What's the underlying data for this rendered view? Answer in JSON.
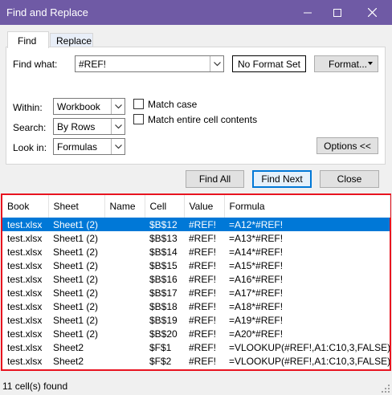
{
  "window": {
    "title": "Find and Replace"
  },
  "tabs": {
    "find": "Find",
    "replace": "Replace"
  },
  "find_what": {
    "label": "Find what:",
    "value": "#REF!",
    "format_status": "No Format Set",
    "format_button": "Format..."
  },
  "within": {
    "label": "Within:",
    "value": "Workbook"
  },
  "search": {
    "label": "Search:",
    "value": "By Rows"
  },
  "look_in": {
    "label": "Look in:",
    "value": "Formulas"
  },
  "options": {
    "match_case": "Match case",
    "match_entire": "Match entire cell contents",
    "options_button": "Options <<"
  },
  "actions": {
    "find_all": "Find All",
    "find_next": "Find Next",
    "close": "Close"
  },
  "results": {
    "columns": [
      "Book",
      "Sheet",
      "Name",
      "Cell",
      "Value",
      "Formula"
    ],
    "rows": [
      [
        "test.xlsx",
        "Sheet1 (2)",
        "",
        "$B$12",
        "#REF!",
        "=A12*#REF!"
      ],
      [
        "test.xlsx",
        "Sheet1 (2)",
        "",
        "$B$13",
        "#REF!",
        "=A13*#REF!"
      ],
      [
        "test.xlsx",
        "Sheet1 (2)",
        "",
        "$B$14",
        "#REF!",
        "=A14*#REF!"
      ],
      [
        "test.xlsx",
        "Sheet1 (2)",
        "",
        "$B$15",
        "#REF!",
        "=A15*#REF!"
      ],
      [
        "test.xlsx",
        "Sheet1 (2)",
        "",
        "$B$16",
        "#REF!",
        "=A16*#REF!"
      ],
      [
        "test.xlsx",
        "Sheet1 (2)",
        "",
        "$B$17",
        "#REF!",
        "=A17*#REF!"
      ],
      [
        "test.xlsx",
        "Sheet1 (2)",
        "",
        "$B$18",
        "#REF!",
        "=A18*#REF!"
      ],
      [
        "test.xlsx",
        "Sheet1 (2)",
        "",
        "$B$19",
        "#REF!",
        "=A19*#REF!"
      ],
      [
        "test.xlsx",
        "Sheet1 (2)",
        "",
        "$B$20",
        "#REF!",
        "=A20*#REF!"
      ],
      [
        "test.xlsx",
        "Sheet2",
        "",
        "$F$1",
        "#REF!",
        "=VLOOKUP(#REF!,A1:C10,3,FALSE)"
      ],
      [
        "test.xlsx",
        "Sheet2",
        "",
        "$F$2",
        "#REF!",
        "=VLOOKUP(#REF!,A1:C10,3,FALSE)"
      ]
    ]
  },
  "status": {
    "text": "11 cell(s) found"
  },
  "colors": {
    "titlebar": "#6f5aa5",
    "selection": "#0078d7",
    "highlight_border": "#e8131f"
  },
  "icons": [
    "minimize-icon",
    "maximize-icon",
    "close-icon",
    "dropdown-arrow-icon",
    "resize-grip-icon"
  ]
}
